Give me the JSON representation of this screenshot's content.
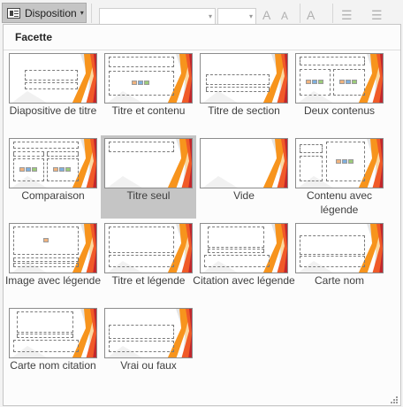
{
  "ribbon": {
    "layout_button_label": "Disposition",
    "layout_icon": "slide-layout-icon",
    "caret_glyph": "▾"
  },
  "panel": {
    "section_title": "Facette",
    "accent_color": "#f05a28",
    "selected_index": 5,
    "layouts": [
      {
        "label": "Diapositive de titre"
      },
      {
        "label": "Titre et contenu"
      },
      {
        "label": "Titre de section"
      },
      {
        "label": "Deux contenus"
      },
      {
        "label": "Comparaison"
      },
      {
        "label": "Titre seul"
      },
      {
        "label": "Vide"
      },
      {
        "label": "Contenu avec légende"
      },
      {
        "label": "Image avec légende"
      },
      {
        "label": "Titre et légende"
      },
      {
        "label": "Citation avec légende"
      },
      {
        "label": "Carte nom"
      },
      {
        "label": "Carte nom citation"
      },
      {
        "label": "Vrai ou faux"
      }
    ]
  }
}
